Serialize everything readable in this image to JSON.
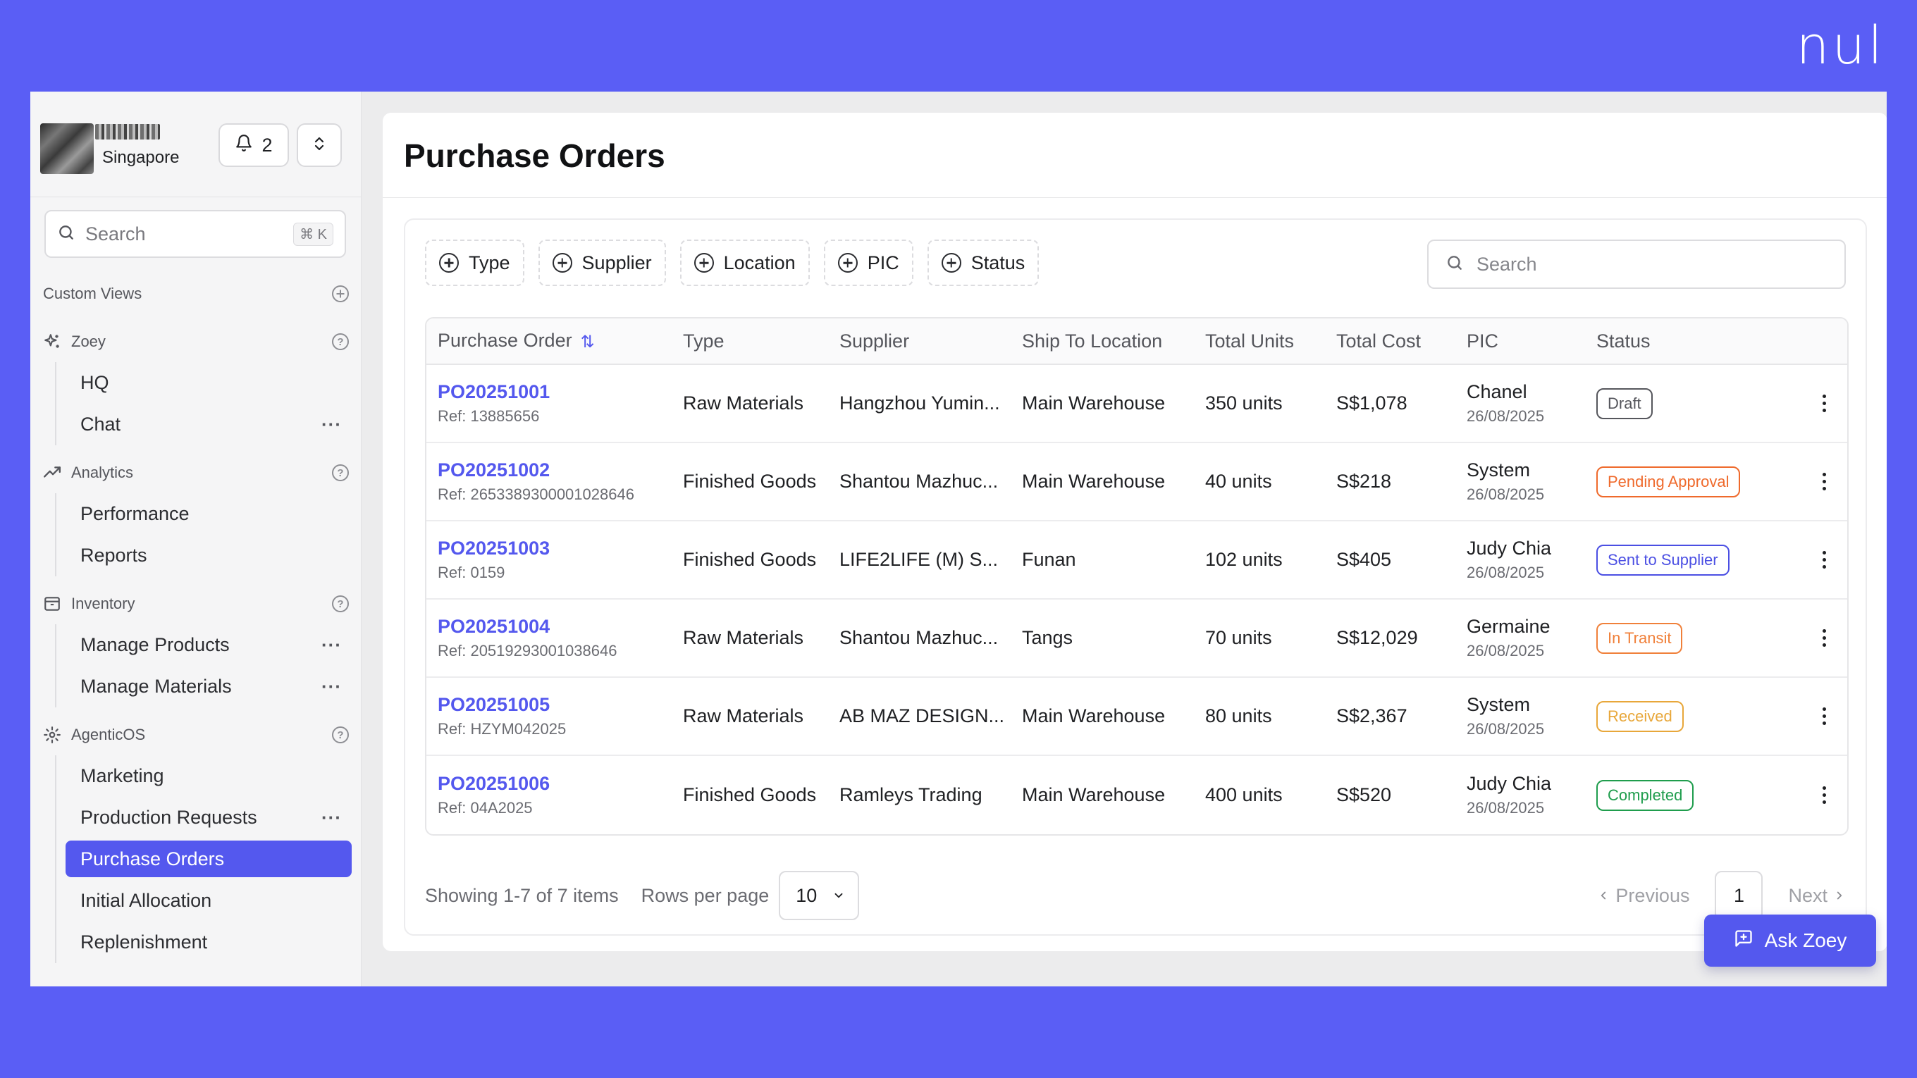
{
  "brand": "nul",
  "account": {
    "location": "Singapore",
    "notification_count": "2"
  },
  "sidebar": {
    "search_placeholder": "Search",
    "search_shortcut": "⌘ K",
    "custom_views": "Custom Views",
    "sections": [
      {
        "label": "Zoey",
        "items": [
          {
            "label": "HQ"
          },
          {
            "label": "Chat"
          }
        ]
      },
      {
        "label": "Analytics",
        "items": [
          {
            "label": "Performance"
          },
          {
            "label": "Reports"
          }
        ]
      },
      {
        "label": "Inventory",
        "items": [
          {
            "label": "Manage Products"
          },
          {
            "label": "Manage Materials"
          }
        ]
      },
      {
        "label": "AgenticOS",
        "items": [
          {
            "label": "Marketing"
          },
          {
            "label": "Production Requests"
          },
          {
            "label": "Purchase Orders"
          },
          {
            "label": "Initial Allocation"
          },
          {
            "label": "Replenishment"
          }
        ]
      }
    ]
  },
  "page": {
    "title": "Purchase Orders"
  },
  "filters": [
    "Type",
    "Supplier",
    "Location",
    "PIC",
    "Status"
  ],
  "table_search_placeholder": "Search",
  "table": {
    "columns": [
      "Purchase Order",
      "Type",
      "Supplier",
      "Ship To Location",
      "Total Units",
      "Total Cost",
      "PIC",
      "Status"
    ],
    "rows": [
      {
        "po": "PO20251001",
        "ref": "Ref: 13885656",
        "type": "Raw Materials",
        "supplier": "Hangzhou Yumin...",
        "location": "Main Warehouse",
        "units": "350 units",
        "cost": "S$1,078",
        "pic": "Chanel",
        "date": "26/08/2025",
        "status": "Draft",
        "status_color": "#55565c"
      },
      {
        "po": "PO20251002",
        "ref": "Ref: 2653389300001028646",
        "type": "Finished Goods",
        "supplier": "Shantou Mazhuc...",
        "location": "Main Warehouse",
        "units": "40 units",
        "cost": "S$218",
        "pic": "System",
        "date": "26/08/2025",
        "status": "Pending Approval",
        "status_color": "#ef6a2c"
      },
      {
        "po": "PO20251003",
        "ref": "Ref: 0159",
        "type": "Finished Goods",
        "supplier": "LIFE2LIFE (M) S...",
        "location": "Funan",
        "units": "102 units",
        "cost": "S$405",
        "pic": "Judy Chia",
        "date": "26/08/2025",
        "status": "Sent to Supplier",
        "status_color": "#4b4fe3"
      },
      {
        "po": "PO20251004",
        "ref": "Ref: 20519293001038646",
        "type": "Raw Materials",
        "supplier": "Shantou Mazhuc...",
        "location": "Tangs",
        "units": "70 units",
        "cost": "S$12,029",
        "pic": "Germaine",
        "date": "26/08/2025",
        "status": "In Transit",
        "status_color": "#f0803a"
      },
      {
        "po": "PO20251005",
        "ref": "Ref: HZYM042025",
        "type": "Raw Materials",
        "supplier": "AB MAZ DESIGN...",
        "location": "Main Warehouse",
        "units": "80 units",
        "cost": "S$2,367",
        "pic": "System",
        "date": "26/08/2025",
        "status": "Received",
        "status_color": "#e8a73a"
      },
      {
        "po": "PO20251006",
        "ref": "Ref: 04A2025",
        "type": "Finished Goods",
        "supplier": "Ramleys Trading",
        "location": "Main Warehouse",
        "units": "400 units",
        "cost": "S$520",
        "pic": "Judy Chia",
        "date": "26/08/2025",
        "status": "Completed",
        "status_color": "#1f9d4d"
      }
    ]
  },
  "footer": {
    "showing": "Showing 1-7 of 7 items",
    "rows_per_page_label": "Rows per page",
    "rows_per_page_value": "10",
    "previous": "Previous",
    "current_page": "1",
    "next": "Next"
  },
  "ask_button": "Ask Zoey"
}
